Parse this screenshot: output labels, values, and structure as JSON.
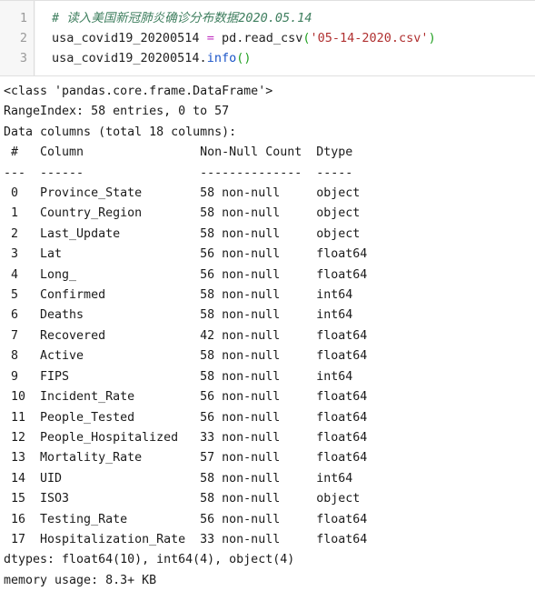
{
  "code_cell": {
    "lines": [
      {
        "number": "1",
        "tokens": [
          {
            "type": "comment",
            "text": "# 读入美国新冠肺炎确诊分布数据2020.05.14"
          }
        ]
      },
      {
        "number": "2",
        "tokens": [
          {
            "type": "plain",
            "text": "usa_covid19_20200514 "
          },
          {
            "type": "op",
            "text": "="
          },
          {
            "type": "plain",
            "text": " pd.read_csv"
          },
          {
            "type": "paren",
            "text": "("
          },
          {
            "type": "str",
            "text": "'05-14-2020.csv'"
          },
          {
            "type": "paren",
            "text": ")"
          }
        ]
      },
      {
        "number": "3",
        "tokens": [
          {
            "type": "plain",
            "text": "usa_covid19_20200514."
          },
          {
            "type": "fn",
            "text": "info"
          },
          {
            "type": "paren",
            "text": "()"
          }
        ]
      }
    ]
  },
  "output": {
    "header_lines": [
      "<class 'pandas.core.frame.DataFrame'>",
      "RangeIndex: 58 entries, 0 to 57",
      "Data columns (total 18 columns):"
    ],
    "table_header": " #   Column                Non-Null Count  Dtype  ",
    "table_rule": "---  ------                --------------  -----  ",
    "rows": [
      {
        "index": "0",
        "column": "Province_State",
        "non_null": "58 non-null",
        "dtype": "object"
      },
      {
        "index": "1",
        "column": "Country_Region",
        "non_null": "58 non-null",
        "dtype": "object"
      },
      {
        "index": "2",
        "column": "Last_Update",
        "non_null": "58 non-null",
        "dtype": "object"
      },
      {
        "index": "3",
        "column": "Lat",
        "non_null": "56 non-null",
        "dtype": "float64"
      },
      {
        "index": "4",
        "column": "Long_",
        "non_null": "56 non-null",
        "dtype": "float64"
      },
      {
        "index": "5",
        "column": "Confirmed",
        "non_null": "58 non-null",
        "dtype": "int64"
      },
      {
        "index": "6",
        "column": "Deaths",
        "non_null": "58 non-null",
        "dtype": "int64"
      },
      {
        "index": "7",
        "column": "Recovered",
        "non_null": "42 non-null",
        "dtype": "float64"
      },
      {
        "index": "8",
        "column": "Active",
        "non_null": "58 non-null",
        "dtype": "float64"
      },
      {
        "index": "9",
        "column": "FIPS",
        "non_null": "58 non-null",
        "dtype": "int64"
      },
      {
        "index": "10",
        "column": "Incident_Rate",
        "non_null": "56 non-null",
        "dtype": "float64"
      },
      {
        "index": "11",
        "column": "People_Tested",
        "non_null": "56 non-null",
        "dtype": "float64"
      },
      {
        "index": "12",
        "column": "People_Hospitalized",
        "non_null": "33 non-null",
        "dtype": "float64"
      },
      {
        "index": "13",
        "column": "Mortality_Rate",
        "non_null": "57 non-null",
        "dtype": "float64"
      },
      {
        "index": "14",
        "column": "UID",
        "non_null": "58 non-null",
        "dtype": "int64"
      },
      {
        "index": "15",
        "column": "ISO3",
        "non_null": "58 non-null",
        "dtype": "object"
      },
      {
        "index": "16",
        "column": "Testing_Rate",
        "non_null": "56 non-null",
        "dtype": "float64"
      },
      {
        "index": "17",
        "column": "Hospitalization_Rate",
        "non_null": "33 non-null",
        "dtype": "float64"
      }
    ],
    "footer_lines": [
      "dtypes: float64(10), int64(4), object(4)",
      "memory usage: 8.3+ KB"
    ]
  },
  "colors": {
    "comment": "#3f7f5f",
    "operator": "#c030c0",
    "string": "#b03030",
    "function": "#1a54c8",
    "paren": "#22a022",
    "plain_text": "#222222",
    "line_number": "#9a9a9a",
    "cell_background": "#f7f7f7",
    "output_text": "#1a1a1a"
  }
}
